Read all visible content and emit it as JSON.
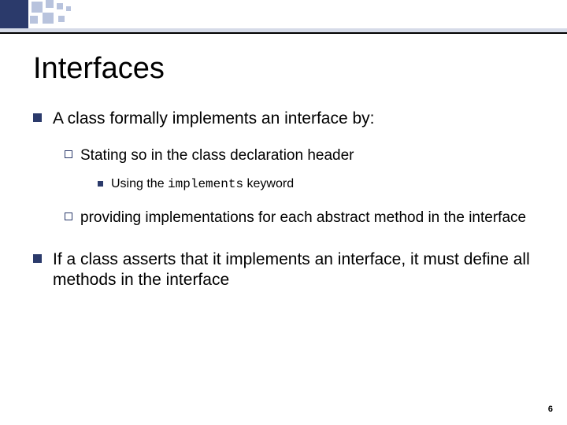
{
  "title": "Interfaces",
  "bullets": {
    "p1": "A class formally implements an interface by:",
    "p1a": "Stating so in the class declaration header",
    "p1a1_before": "Using the ",
    "p1a1_code": "implements",
    "p1a1_after": " keyword",
    "p1b": "providing implementations for each abstract method in the interface",
    "p2": "If a class asserts that it implements an interface, it must define all methods in the interface"
  },
  "page_number": "6"
}
